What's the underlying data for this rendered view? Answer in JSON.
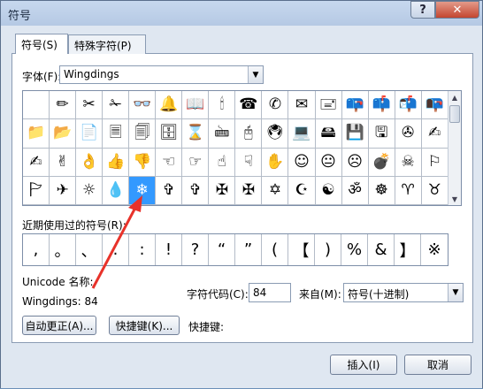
{
  "window": {
    "title": "符号",
    "help_label": "?",
    "close_label": "✕"
  },
  "tabs": [
    {
      "label": "符号(S)",
      "active": true
    },
    {
      "label": "特殊字符(P)",
      "active": false
    }
  ],
  "font": {
    "label": "字体(F):",
    "value": "Wingdings"
  },
  "symbol_grid": {
    "rows": [
      [
        " ",
        "✏",
        "✂",
        "✁",
        "👓",
        "🔔",
        "📖",
        "🕯",
        "☎",
        "✆",
        "✉",
        "🖃",
        "📪",
        "📫",
        "📬",
        "📭"
      ],
      [
        "📁",
        "📂",
        "📄",
        "🗏",
        "🗐",
        "🗄",
        "⌛",
        "🖮",
        "🖰",
        "🖲",
        "💻",
        "🖴",
        "💾",
        "🖫",
        "✇",
        "✍"
      ],
      [
        "✍",
        "✌",
        "👌",
        "👍",
        "👎",
        "☜",
        "☞",
        "☝",
        "☟",
        "✋",
        "☺",
        "😐",
        "☹",
        "💣",
        "☠",
        "⚐"
      ],
      [
        "🏱",
        "✈",
        "☼",
        "💧",
        "❄",
        "✞",
        "✞",
        "✠",
        "✠",
        "✡",
        "☪",
        "☯",
        "ॐ",
        "☸",
        "♈",
        "♉"
      ]
    ],
    "selected": "❄"
  },
  "recent": {
    "label": "近期使用过的符号(R):",
    "symbols": [
      ",",
      "。",
      "、",
      ".",
      ":",
      "!",
      "?",
      "“",
      "”",
      "(",
      "【",
      ")",
      "%",
      "&",
      "】",
      "※"
    ]
  },
  "info": {
    "unicode_label": "Unicode 名称:",
    "char_name": "Wingdings: 84",
    "code_label": "字符代码(C):",
    "code_value": "84",
    "from_label": "来自(M):",
    "from_value": "符号(十进制)"
  },
  "buttons": {
    "autocorrect": "自动更正(A)...",
    "shortcut_key": "快捷键(K)...",
    "shortcut_text": "快捷键:",
    "insert": "插入(I)",
    "cancel": "取消"
  },
  "colors": {
    "selection": "#3399ff",
    "annotation_arrow": "#e8322a"
  }
}
